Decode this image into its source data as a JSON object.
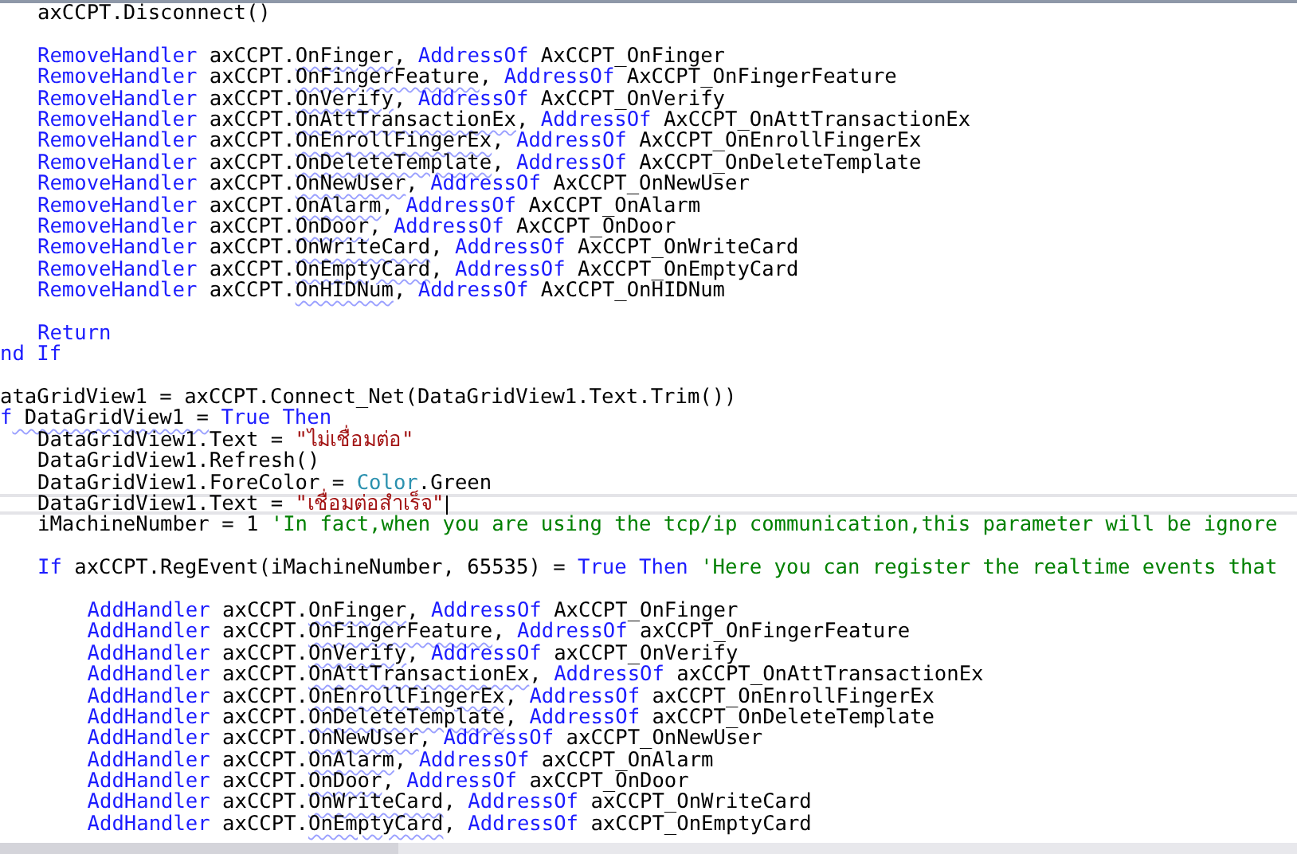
{
  "editor": {
    "lines": [
      {
        "current": false,
        "kind": "outer",
        "tokens": [
          {
            "kind": "plain",
            "text": "axCCPT.Disconnect()"
          }
        ]
      },
      {
        "current": false,
        "kind": "edge"
      },
      {
        "current": false,
        "kind": "outer",
        "tokens": [
          {
            "kind": "keyword",
            "text": "RemoveHandler"
          },
          {
            "kind": "plain",
            "text": " axCCPT."
          },
          {
            "kind": "member",
            "text": "OnFinger"
          },
          {
            "kind": "plain",
            "text": ", "
          },
          {
            "kind": "keyword",
            "text": "AddressOf"
          },
          {
            "kind": "plain",
            "text": " AxCCPT_OnFinger"
          }
        ]
      },
      {
        "current": false,
        "kind": "outer",
        "tokens": [
          {
            "kind": "keyword",
            "text": "RemoveHandler"
          },
          {
            "kind": "plain",
            "text": " axCCPT."
          },
          {
            "kind": "member",
            "text": "OnFingerFeature"
          },
          {
            "kind": "plain",
            "text": ", "
          },
          {
            "kind": "keyword",
            "text": "AddressOf"
          },
          {
            "kind": "plain",
            "text": " AxCCPT_OnFingerFeature"
          }
        ]
      },
      {
        "current": false,
        "kind": "outer",
        "tokens": [
          {
            "kind": "keyword",
            "text": "RemoveHandler"
          },
          {
            "kind": "plain",
            "text": " axCCPT."
          },
          {
            "kind": "member",
            "text": "OnVerify"
          },
          {
            "kind": "plain",
            "text": ", "
          },
          {
            "kind": "keyword",
            "text": "AddressOf"
          },
          {
            "kind": "plain",
            "text": " AxCCPT_OnVerify"
          }
        ]
      },
      {
        "current": false,
        "kind": "outer",
        "tokens": [
          {
            "kind": "keyword",
            "text": "RemoveHandler"
          },
          {
            "kind": "plain",
            "text": " axCCPT."
          },
          {
            "kind": "member",
            "text": "OnAttTransactionEx"
          },
          {
            "kind": "plain",
            "text": ", "
          },
          {
            "kind": "keyword",
            "text": "AddressOf"
          },
          {
            "kind": "plain",
            "text": " AxCCPT_OnAttTransactionEx"
          }
        ]
      },
      {
        "current": false,
        "kind": "outer",
        "tokens": [
          {
            "kind": "keyword",
            "text": "RemoveHandler"
          },
          {
            "kind": "plain",
            "text": " axCCPT."
          },
          {
            "kind": "member",
            "text": "OnEnrollFingerEx"
          },
          {
            "kind": "plain",
            "text": ", "
          },
          {
            "kind": "keyword",
            "text": "AddressOf"
          },
          {
            "kind": "plain",
            "text": " AxCCPT_OnEnrollFingerEx"
          }
        ]
      },
      {
        "current": false,
        "kind": "outer",
        "tokens": [
          {
            "kind": "keyword",
            "text": "RemoveHandler"
          },
          {
            "kind": "plain",
            "text": " axCCPT."
          },
          {
            "kind": "member",
            "text": "OnDeleteTemplate"
          },
          {
            "kind": "plain",
            "text": ", "
          },
          {
            "kind": "keyword",
            "text": "AddressOf"
          },
          {
            "kind": "plain",
            "text": " AxCCPT_OnDeleteTemplate"
          }
        ]
      },
      {
        "current": false,
        "kind": "outer",
        "tokens": [
          {
            "kind": "keyword",
            "text": "RemoveHandler"
          },
          {
            "kind": "plain",
            "text": " axCCPT."
          },
          {
            "kind": "member",
            "text": "OnNewUser"
          },
          {
            "kind": "plain",
            "text": ", "
          },
          {
            "kind": "keyword",
            "text": "AddressOf"
          },
          {
            "kind": "plain",
            "text": " AxCCPT_OnNewUser"
          }
        ]
      },
      {
        "current": false,
        "kind": "outer",
        "tokens": [
          {
            "kind": "keyword",
            "text": "RemoveHandler"
          },
          {
            "kind": "plain",
            "text": " axCCPT."
          },
          {
            "kind": "member",
            "text": "OnAlarm"
          },
          {
            "kind": "plain",
            "text": ", "
          },
          {
            "kind": "keyword",
            "text": "AddressOf"
          },
          {
            "kind": "plain",
            "text": " AxCCPT_OnAlarm"
          }
        ]
      },
      {
        "current": false,
        "kind": "outer",
        "tokens": [
          {
            "kind": "keyword",
            "text": "RemoveHandler"
          },
          {
            "kind": "plain",
            "text": " axCCPT."
          },
          {
            "kind": "member",
            "text": "OnDoor"
          },
          {
            "kind": "plain",
            "text": ", "
          },
          {
            "kind": "keyword",
            "text": "AddressOf"
          },
          {
            "kind": "plain",
            "text": " AxCCPT_OnDoor"
          }
        ]
      },
      {
        "current": false,
        "kind": "outer",
        "tokens": [
          {
            "kind": "keyword",
            "text": "RemoveHandler"
          },
          {
            "kind": "plain",
            "text": " axCCPT."
          },
          {
            "kind": "member",
            "text": "OnWriteCard"
          },
          {
            "kind": "plain",
            "text": ", "
          },
          {
            "kind": "keyword",
            "text": "AddressOf"
          },
          {
            "kind": "plain",
            "text": " AxCCPT_OnWriteCard"
          }
        ]
      },
      {
        "current": false,
        "kind": "outer",
        "tokens": [
          {
            "kind": "keyword",
            "text": "RemoveHandler"
          },
          {
            "kind": "plain",
            "text": " axCCPT."
          },
          {
            "kind": "member",
            "text": "OnEmptyCard"
          },
          {
            "kind": "plain",
            "text": ", "
          },
          {
            "kind": "keyword",
            "text": "AddressOf"
          },
          {
            "kind": "plain",
            "text": " AxCCPT_OnEmptyCard"
          }
        ]
      },
      {
        "current": false,
        "kind": "outer",
        "tokens": [
          {
            "kind": "keyword",
            "text": "RemoveHandler"
          },
          {
            "kind": "plain",
            "text": " axCCPT."
          },
          {
            "kind": "member",
            "text": "OnHIDNum"
          },
          {
            "kind": "plain",
            "text": ", "
          },
          {
            "kind": "keyword",
            "text": "AddressOf"
          },
          {
            "kind": "plain",
            "text": " AxCCPT_OnHIDNum"
          }
        ]
      },
      {
        "current": false,
        "kind": "edge"
      },
      {
        "current": false,
        "kind": "outer",
        "tokens": [
          {
            "kind": "keyword",
            "text": "Return"
          }
        ]
      },
      {
        "current": false,
        "kind": "edge",
        "tokens": [
          {
            "kind": "keyword",
            "text": "nd If"
          }
        ]
      },
      {
        "current": false,
        "kind": "edge"
      },
      {
        "current": false,
        "kind": "edge",
        "tokens": [
          {
            "kind": "plain",
            "text": "ataGridView1 = axCCPT.Connect_Net(DataGridView1.Text.Trim())"
          }
        ]
      },
      {
        "current": false,
        "kind": "edge",
        "tokens": [
          {
            "kind": "keyword",
            "text": "f"
          },
          {
            "kind": "member",
            "text": " DataGridView1 ="
          },
          {
            "kind": "keyword",
            "text": " True Then"
          }
        ]
      },
      {
        "current": false,
        "kind": "outer",
        "tokens": [
          {
            "kind": "plain",
            "text": "DataGridView1.Text = "
          },
          {
            "kind": "string",
            "text": "\"ไม่เชื่อมต่อ\""
          }
        ]
      },
      {
        "current": false,
        "kind": "outer",
        "tokens": [
          {
            "kind": "plain",
            "text": "DataGridView1.Refresh()"
          }
        ]
      },
      {
        "current": false,
        "kind": "outer",
        "tokens": [
          {
            "kind": "plain",
            "text": "DataGridView1.ForeColor = "
          },
          {
            "kind": "type",
            "text": "Color"
          },
          {
            "kind": "plain",
            "text": ".Green"
          }
        ]
      },
      {
        "current": true,
        "kind": "outer",
        "tokens": [
          {
            "kind": "plain",
            "text": "DataGridView1.Text = "
          },
          {
            "kind": "string",
            "text": "\"เชื่อมต่อสำเร็จ\""
          }
        ]
      },
      {
        "current": false,
        "kind": "outer",
        "tokens": [
          {
            "kind": "plain",
            "text": "iMachineNumber = 1 "
          },
          {
            "kind": "comment",
            "text": "'In fact,when you are using the tcp/ip communication,this parameter will be ignore"
          }
        ]
      },
      {
        "current": false,
        "kind": "edge"
      },
      {
        "current": false,
        "kind": "outer",
        "tokens": [
          {
            "kind": "keyword",
            "text": "If"
          },
          {
            "kind": "plain",
            "text": " axCCPT.RegEvent(iMachineNumber, 65535) = "
          },
          {
            "kind": "keyword",
            "text": "True Then"
          },
          {
            "kind": "comment",
            "text": " 'Here you can register the realtime events that"
          }
        ]
      },
      {
        "current": false,
        "kind": "edge"
      },
      {
        "current": false,
        "kind": "inner",
        "tokens": [
          {
            "kind": "keyword",
            "text": "AddHandler"
          },
          {
            "kind": "plain",
            "text": " axCCPT."
          },
          {
            "kind": "member",
            "text": "OnFinger"
          },
          {
            "kind": "plain",
            "text": ", "
          },
          {
            "kind": "keyword",
            "text": "AddressOf"
          },
          {
            "kind": "plain",
            "text": " AxCCPT_OnFinger"
          }
        ]
      },
      {
        "current": false,
        "kind": "inner",
        "tokens": [
          {
            "kind": "keyword",
            "text": "AddHandler"
          },
          {
            "kind": "plain",
            "text": " axCCPT."
          },
          {
            "kind": "member",
            "text": "OnFingerFeature"
          },
          {
            "kind": "plain",
            "text": ", "
          },
          {
            "kind": "keyword",
            "text": "AddressOf"
          },
          {
            "kind": "plain",
            "text": " axCCPT_OnFingerFeature"
          }
        ]
      },
      {
        "current": false,
        "kind": "inner",
        "tokens": [
          {
            "kind": "keyword",
            "text": "AddHandler"
          },
          {
            "kind": "plain",
            "text": " axCCPT."
          },
          {
            "kind": "member",
            "text": "OnVerify"
          },
          {
            "kind": "plain",
            "text": ", "
          },
          {
            "kind": "keyword",
            "text": "AddressOf"
          },
          {
            "kind": "plain",
            "text": " axCCPT_OnVerify"
          }
        ]
      },
      {
        "current": false,
        "kind": "inner",
        "tokens": [
          {
            "kind": "keyword",
            "text": "AddHandler"
          },
          {
            "kind": "plain",
            "text": " axCCPT."
          },
          {
            "kind": "member",
            "text": "OnAttTransactionEx"
          },
          {
            "kind": "plain",
            "text": ", "
          },
          {
            "kind": "keyword",
            "text": "AddressOf"
          },
          {
            "kind": "plain",
            "text": " axCCPT_OnAttTransactionEx"
          }
        ]
      },
      {
        "current": false,
        "kind": "inner",
        "tokens": [
          {
            "kind": "keyword",
            "text": "AddHandler"
          },
          {
            "kind": "plain",
            "text": " axCCPT."
          },
          {
            "kind": "member",
            "text": "OnEnrollFingerEx"
          },
          {
            "kind": "plain",
            "text": ", "
          },
          {
            "kind": "keyword",
            "text": "AddressOf"
          },
          {
            "kind": "plain",
            "text": " axCCPT_OnEnrollFingerEx"
          }
        ]
      },
      {
        "current": false,
        "kind": "inner",
        "tokens": [
          {
            "kind": "keyword",
            "text": "AddHandler"
          },
          {
            "kind": "plain",
            "text": " axCCPT."
          },
          {
            "kind": "member",
            "text": "OnDeleteTemplate"
          },
          {
            "kind": "plain",
            "text": ", "
          },
          {
            "kind": "keyword",
            "text": "AddressOf"
          },
          {
            "kind": "plain",
            "text": " axCCPT_OnDeleteTemplate"
          }
        ]
      },
      {
        "current": false,
        "kind": "inner",
        "tokens": [
          {
            "kind": "keyword",
            "text": "AddHandler"
          },
          {
            "kind": "plain",
            "text": " axCCPT."
          },
          {
            "kind": "member",
            "text": "OnNewUser"
          },
          {
            "kind": "plain",
            "text": ", "
          },
          {
            "kind": "keyword",
            "text": "AddressOf"
          },
          {
            "kind": "plain",
            "text": " axCCPT_OnNewUser"
          }
        ]
      },
      {
        "current": false,
        "kind": "inner",
        "tokens": [
          {
            "kind": "keyword",
            "text": "AddHandler"
          },
          {
            "kind": "plain",
            "text": " axCCPT."
          },
          {
            "kind": "member",
            "text": "OnAlarm"
          },
          {
            "kind": "plain",
            "text": ", "
          },
          {
            "kind": "keyword",
            "text": "AddressOf"
          },
          {
            "kind": "plain",
            "text": " axCCPT_OnAlarm"
          }
        ]
      },
      {
        "current": false,
        "kind": "inner",
        "tokens": [
          {
            "kind": "keyword",
            "text": "AddHandler"
          },
          {
            "kind": "plain",
            "text": " axCCPT."
          },
          {
            "kind": "member",
            "text": "OnDoor"
          },
          {
            "kind": "plain",
            "text": ", "
          },
          {
            "kind": "keyword",
            "text": "AddressOf"
          },
          {
            "kind": "plain",
            "text": " axCCPT_OnDoor"
          }
        ]
      },
      {
        "current": false,
        "kind": "inner",
        "tokens": [
          {
            "kind": "keyword",
            "text": "AddHandler"
          },
          {
            "kind": "plain",
            "text": " axCCPT."
          },
          {
            "kind": "member",
            "text": "OnWriteCard"
          },
          {
            "kind": "plain",
            "text": ", "
          },
          {
            "kind": "keyword",
            "text": "AddressOf"
          },
          {
            "kind": "plain",
            "text": " axCCPT_OnWriteCard"
          }
        ]
      },
      {
        "current": false,
        "kind": "inner",
        "tokens": [
          {
            "kind": "keyword",
            "text": "AddHandler"
          },
          {
            "kind": "plain",
            "text": " axCCPT."
          },
          {
            "kind": "member",
            "text": "OnEmptyCard"
          },
          {
            "kind": "plain",
            "text": ", "
          },
          {
            "kind": "keyword",
            "text": "AddressOf"
          },
          {
            "kind": "plain",
            "text": " axCCPT_OnEmptyCard"
          }
        ]
      }
    ]
  }
}
